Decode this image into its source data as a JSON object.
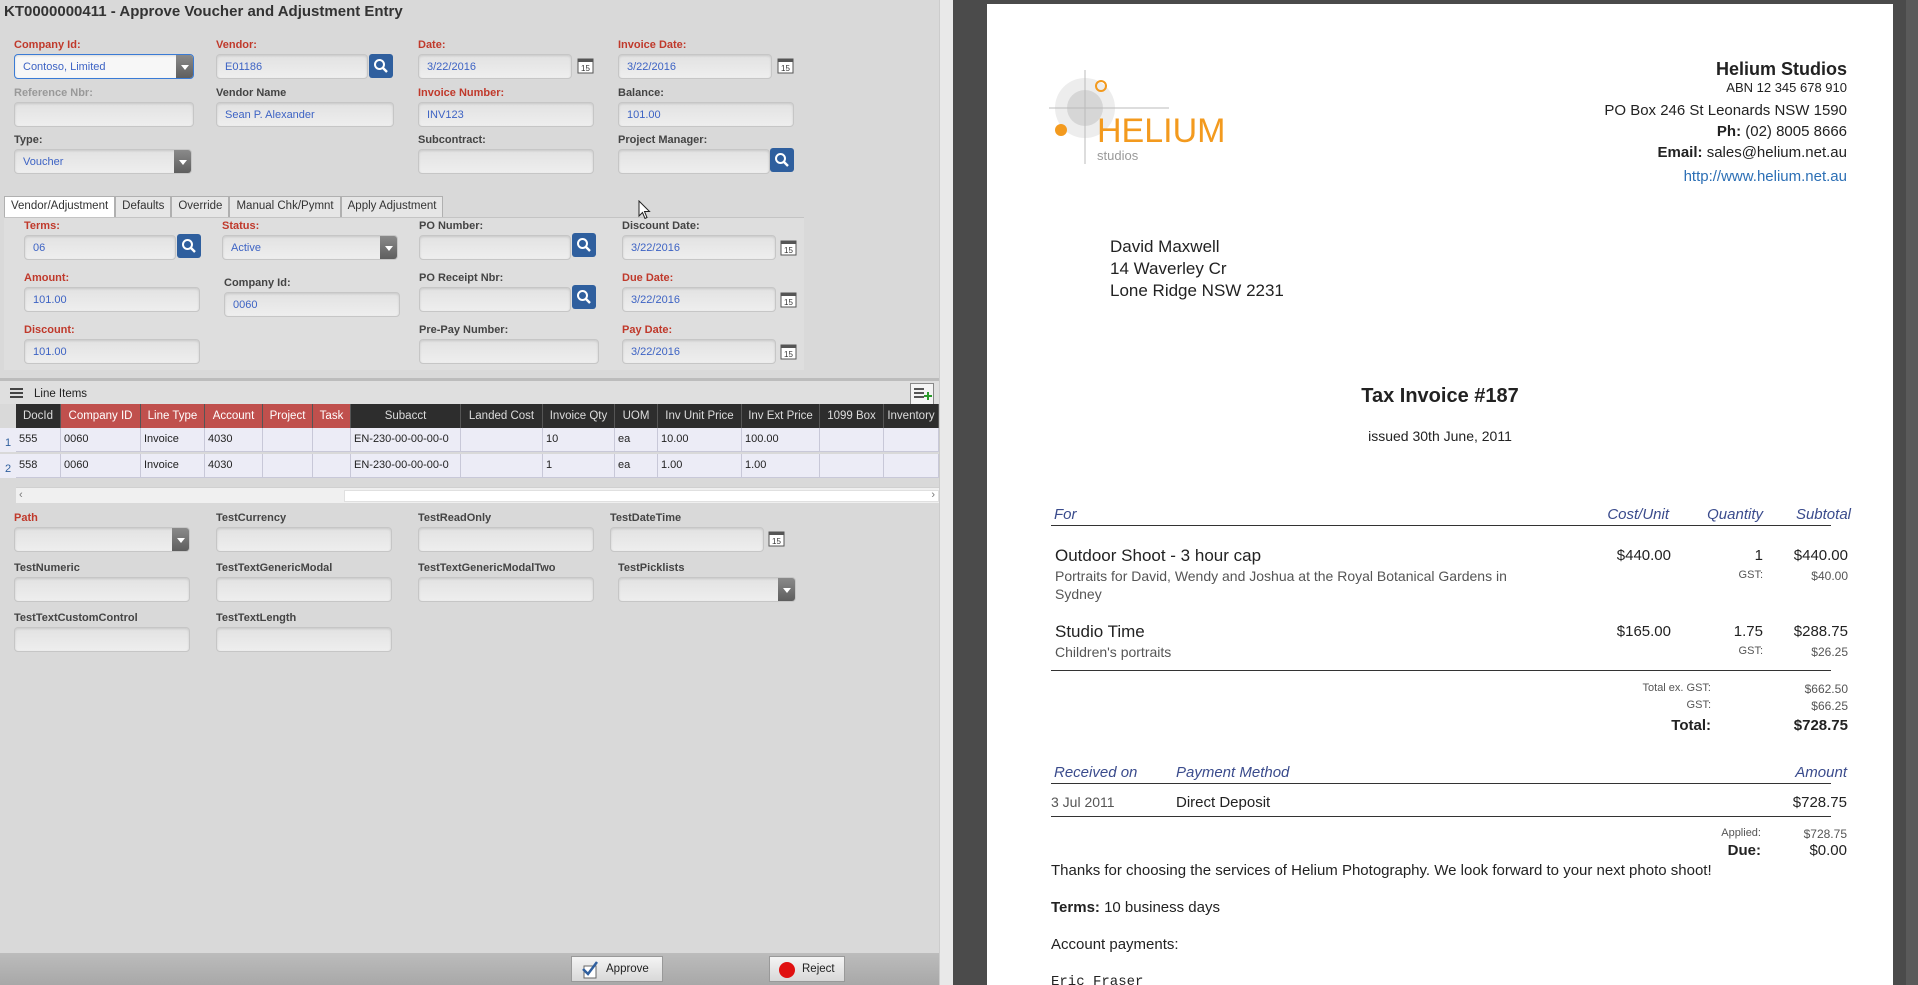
{
  "window": {
    "title": "KT0000000411 - Approve Voucher and Adjustment Entry"
  },
  "header_fields": {
    "company_id": {
      "label": "Company Id:",
      "value": "Contoso, Limited"
    },
    "vendor": {
      "label": "Vendor:",
      "value": "E01186"
    },
    "date": {
      "label": "Date:",
      "value": "3/22/2016"
    },
    "invoice_date": {
      "label": "Invoice Date:",
      "value": "3/22/2016"
    },
    "reference_nbr": {
      "label": "Reference Nbr:",
      "value": ""
    },
    "vendor_name": {
      "label": "Vendor Name",
      "value": "Sean P. Alexander"
    },
    "invoice_number": {
      "label": "Invoice Number:",
      "value": "INV123"
    },
    "balance": {
      "label": "Balance:",
      "value": "101.00"
    },
    "type": {
      "label": "Type:",
      "value": "Voucher"
    },
    "subcontract": {
      "label": "Subcontract:",
      "value": ""
    },
    "project_manager": {
      "label": "Project Manager:",
      "value": ""
    }
  },
  "tabs": [
    {
      "label": "Vendor/Adjustment",
      "active": true
    },
    {
      "label": "Defaults"
    },
    {
      "label": "Override"
    },
    {
      "label": "Manual Chk/Pymnt"
    },
    {
      "label": "Apply Adjustment"
    }
  ],
  "tab_fields": {
    "terms": {
      "label": "Terms:",
      "value": "06"
    },
    "status": {
      "label": "Status:",
      "value": "Active"
    },
    "po_number": {
      "label": "PO Number:",
      "value": ""
    },
    "discount_date": {
      "label": "Discount Date:",
      "value": "3/22/2016"
    },
    "amount": {
      "label": "Amount:",
      "value": "101.00"
    },
    "company_id": {
      "label": "Company Id:",
      "value": "0060"
    },
    "po_receipt_nbr": {
      "label": "PO Receipt Nbr:",
      "value": ""
    },
    "due_date": {
      "label": "Due Date:",
      "value": "3/22/2016"
    },
    "discount": {
      "label": "Discount:",
      "value": "101.00"
    },
    "pre_pay_number": {
      "label": "Pre-Pay Number:",
      "value": ""
    },
    "pay_date": {
      "label": "Pay Date:",
      "value": "3/22/2016"
    }
  },
  "line_items": {
    "title": "Line Items",
    "columns": [
      "DocId",
      "Company ID",
      "Line Type",
      "Account",
      "Project",
      "Task",
      "Subacct",
      "Landed Cost",
      "Invoice Qty",
      "UOM",
      "Inv Unit Price",
      "Inv Ext Price",
      "1099 Box",
      "Inventory"
    ],
    "rows": [
      {
        "num": "1",
        "cells": [
          "555",
          "0060",
          "Invoice",
          "4030",
          "",
          "",
          "EN-230-00-00-00-0",
          "",
          "10",
          "ea",
          "10.00",
          "100.00",
          "",
          ""
        ]
      },
      {
        "num": "2",
        "cells": [
          "558",
          "0060",
          "Invoice",
          "4030",
          "",
          "",
          "EN-230-00-00-00-0",
          "",
          "1",
          "ea",
          "1.00",
          "1.00",
          "",
          ""
        ]
      }
    ]
  },
  "custom_fields": {
    "path": {
      "label": "Path"
    },
    "test_currency": {
      "label": "TestCurrency"
    },
    "test_read_only": {
      "label": "TestReadOnly"
    },
    "test_date_time": {
      "label": "TestDateTime"
    },
    "test_numeric": {
      "label": "TestNumeric"
    },
    "test_text_generic_modal": {
      "label": "TestTextGenericModal"
    },
    "test_text_generic_modal_two": {
      "label": "TestTextGenericModalTwo"
    },
    "test_picklists": {
      "label": "TestPicklists"
    },
    "test_text_custom_control": {
      "label": "TestTextCustomControl"
    },
    "test_text_length": {
      "label": "TestTextLength"
    }
  },
  "footer": {
    "approve_label": "Approve",
    "reject_label": "Reject"
  },
  "calendar_day": "15",
  "invoice_doc": {
    "company_name": "Helium Studios",
    "abn": "ABN 12 345 678 910",
    "address": "PO Box 246 St Leonards NSW 1590",
    "phone_label": "Ph:",
    "phone": "(02) 8005 8666",
    "email_label": "Email:",
    "email": "sales@helium.net.au",
    "website": "http://www.helium.net.au",
    "logo_word": "HELIUM",
    "logo_sub": "studios",
    "recipient": [
      "David Maxwell",
      "14 Waverley Cr",
      "Lone Ridge NSW 2231"
    ],
    "heading": "Tax Invoice #187",
    "issued": "issued 30th June, 2011",
    "table_headers": {
      "for": "For",
      "cost": "Cost/Unit",
      "qty": "Quantity",
      "subtotal": "Subtotal"
    },
    "items": [
      {
        "name": "Outdoor Shoot - 3 hour cap",
        "desc": "Portraits for David, Wendy and Joshua at the Royal Botanical Gardens in",
        "desc2": "Sydney",
        "cost": "$440.00",
        "qty": "1",
        "gst_label": "GST:",
        "subtotal": "$440.00",
        "gst": "$40.00"
      },
      {
        "name": "Studio Time",
        "desc": "Children's portraits",
        "cost": "$165.00",
        "qty": "1.75",
        "gst_label": "GST:",
        "subtotal": "$288.75",
        "gst": "$26.25"
      }
    ],
    "totals": {
      "ex_gst_label": "Total ex. GST:",
      "ex_gst": "$662.50",
      "gst_label": "GST:",
      "gst": "$66.25",
      "total_label": "Total:",
      "total": "$728.75"
    },
    "payments_headers": {
      "received": "Received on",
      "method": "Payment Method",
      "amount": "Amount"
    },
    "payment": {
      "date": "3 Jul 2011",
      "method": "Direct Deposit",
      "amount": "$728.75"
    },
    "applied_label": "Applied:",
    "applied": "$728.75",
    "due_label": "Due:",
    "due": "$0.00",
    "thanks": "Thanks for choosing the services of Helium Photography. We look forward to your next photo shoot!",
    "terms_label": "Terms:",
    "terms": "10 business days",
    "account_payments": "Account payments:",
    "signature_name": "Eric Fraser"
  },
  "colors": {
    "required_label": "#c0392b",
    "value_text": "#3d63c4",
    "button_blue": "#2f5f9e",
    "grid_header": "#2d2d2d",
    "grid_header_red": "#c0504d",
    "logo_orange": "#f39a1e"
  }
}
